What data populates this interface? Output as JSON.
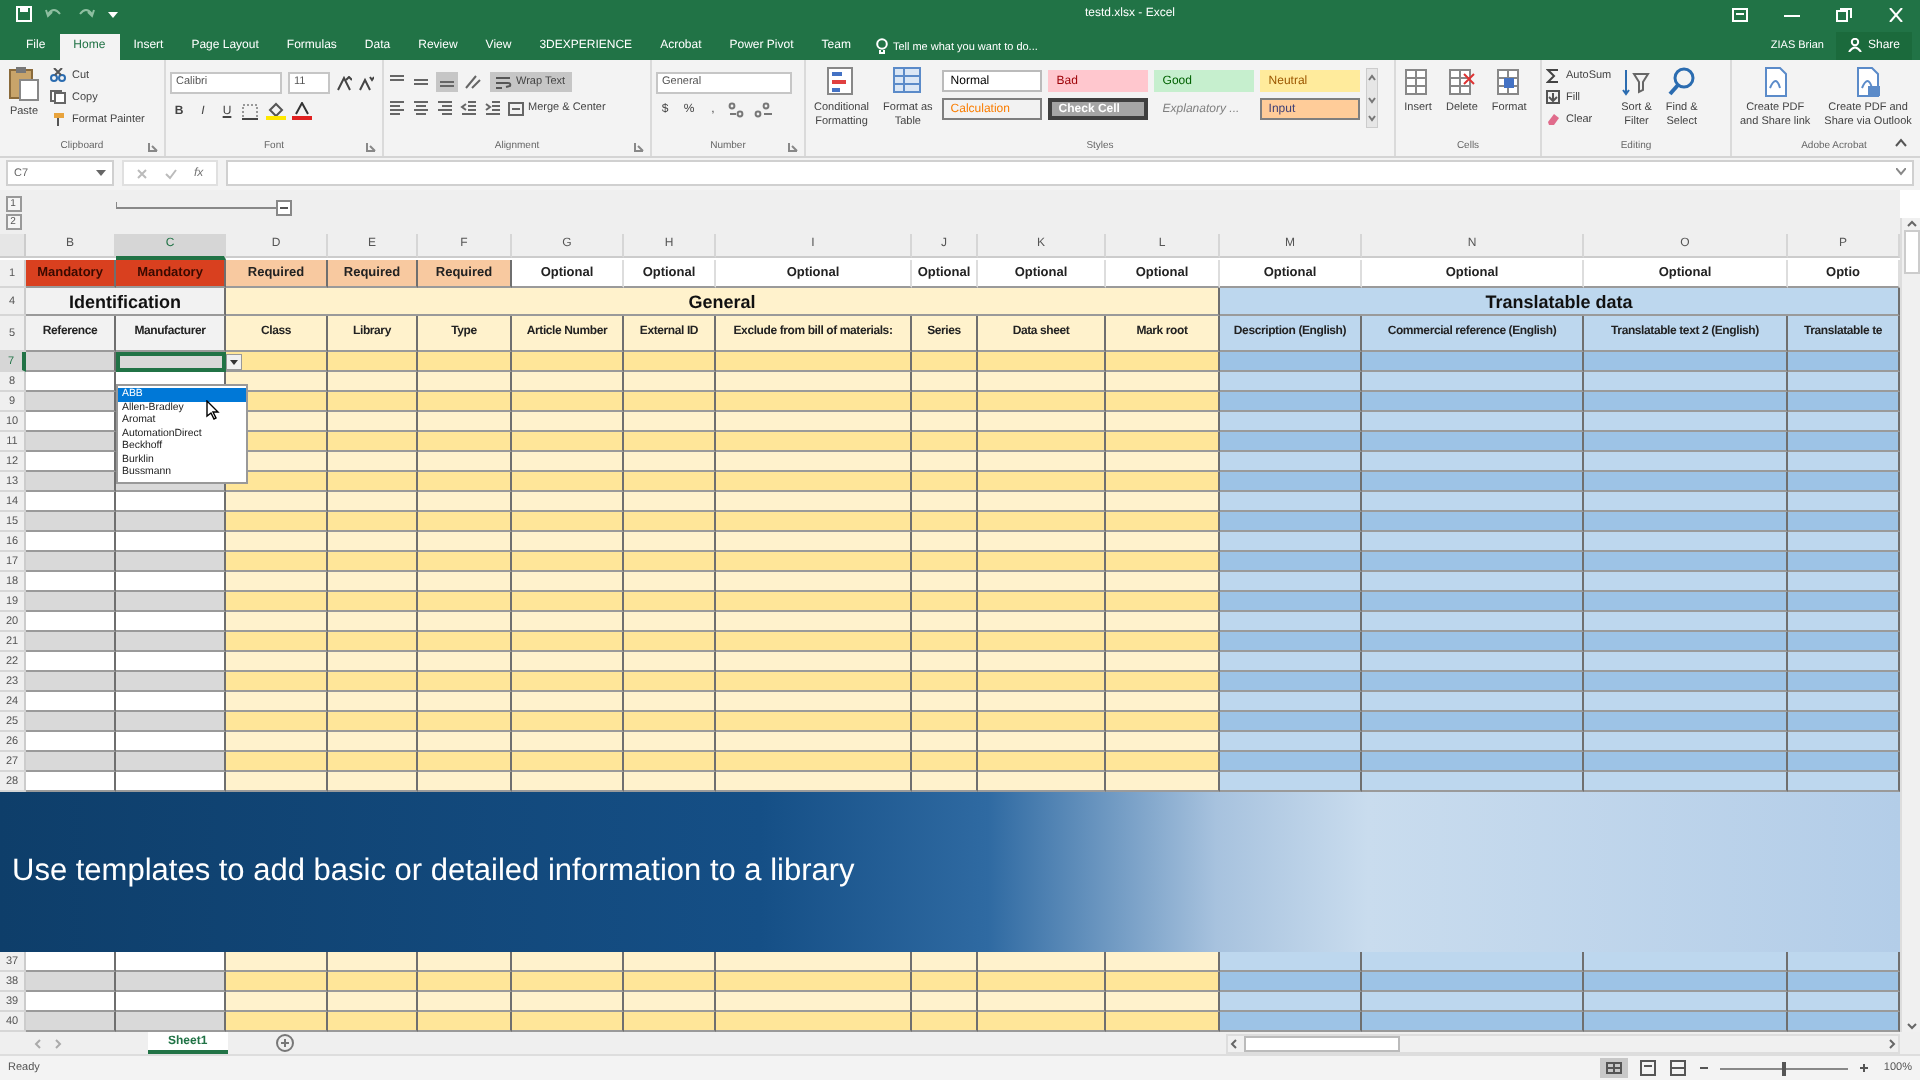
{
  "title_bar": {
    "title": "testd.xlsx - Excel"
  },
  "tabs": [
    {
      "label": "File",
      "selected": false
    },
    {
      "label": "Home",
      "selected": true
    },
    {
      "label": "Insert",
      "selected": false
    },
    {
      "label": "Page Layout",
      "selected": false
    },
    {
      "label": "Formulas",
      "selected": false
    },
    {
      "label": "Data",
      "selected": false
    },
    {
      "label": "Review",
      "selected": false
    },
    {
      "label": "View",
      "selected": false
    },
    {
      "label": "3DEXPERIENCE",
      "selected": false
    },
    {
      "label": "Acrobat",
      "selected": false
    },
    {
      "label": "Power Pivot",
      "selected": false
    },
    {
      "label": "Team",
      "selected": false
    }
  ],
  "tell_me": {
    "placeholder": "Tell me what you want to do..."
  },
  "account": {
    "user": "ZIAS Brian",
    "share": "Share"
  },
  "ribbon": {
    "clipboard": {
      "label": "Clipboard",
      "paste": "Paste",
      "cut": "Cut",
      "copy": "Copy",
      "format_painter": "Format Painter"
    },
    "font": {
      "label": "Font",
      "name": "Calibri",
      "size": "11",
      "bold": "B",
      "italic": "I",
      "underline": "U"
    },
    "alignment": {
      "label": "Alignment",
      "wrap_text": {
        "label": "Wrap Text",
        "on": true
      },
      "merge": "Merge & Center"
    },
    "number": {
      "label": "Number",
      "format": "General",
      "currency": "$",
      "percent": "%",
      "comma": ","
    },
    "styles": {
      "label": "Styles",
      "conditional": [
        "Conditional",
        "Formatting"
      ],
      "format_table": [
        "Format as",
        "Table"
      ],
      "gallery": [
        {
          "label": "Normal",
          "kind": "normal"
        },
        {
          "label": "Bad",
          "kind": "bad"
        },
        {
          "label": "Good",
          "kind": "good"
        },
        {
          "label": "Neutral",
          "kind": "neutral"
        },
        {
          "label": "Calculation",
          "kind": "calculation"
        },
        {
          "label": "Check Cell",
          "kind": "check"
        },
        {
          "label": "Explanatory ...",
          "kind": "explanatory"
        },
        {
          "label": "Input",
          "kind": "input"
        }
      ]
    },
    "cells": {
      "label": "Cells",
      "buttons": [
        "Insert",
        "Delete",
        "Format"
      ]
    },
    "editing": {
      "label": "Editing",
      "autosum": "AutoSum",
      "fill": "Fill",
      "clear": "Clear",
      "sort": [
        "Sort &",
        "Filter"
      ],
      "find": [
        "Find &",
        "Select"
      ]
    },
    "acrobat": {
      "label": "Adobe Acrobat",
      "buttons": [
        [
          "Create PDF",
          "and Share link"
        ],
        [
          "Create PDF and",
          "Share via Outlook"
        ]
      ]
    }
  },
  "formula_bar": {
    "name_box": "C7",
    "function_label": "fx"
  },
  "outline": {
    "levels": [
      "1",
      "2"
    ]
  },
  "sheet": {
    "header_rows": [
      "1",
      "4",
      "5"
    ],
    "sections": [
      {
        "title": "Identification",
        "kind": "identification",
        "columns": [
          {
            "letter": "B",
            "requirement": "Mandatory",
            "kind": "mandatory",
            "heading": "Reference",
            "selected": false
          },
          {
            "letter": "C",
            "requirement": "Mandatory",
            "kind": "mandatory",
            "heading": "Manufacturer",
            "selected": true
          }
        ]
      },
      {
        "title": "General",
        "kind": "general",
        "columns": [
          {
            "letter": "D",
            "requirement": "Required",
            "kind": "required",
            "heading": "Class",
            "selected": false
          },
          {
            "letter": "E",
            "requirement": "Required",
            "kind": "required",
            "heading": "Library",
            "selected": false
          },
          {
            "letter": "F",
            "requirement": "Required",
            "kind": "required",
            "heading": "Type",
            "selected": false
          },
          {
            "letter": "G",
            "requirement": "Optional",
            "kind": "optional",
            "heading": "Article Number",
            "selected": false
          },
          {
            "letter": "H",
            "requirement": "Optional",
            "kind": "optional",
            "heading": "External ID",
            "selected": false
          },
          {
            "letter": "I",
            "requirement": "Optional",
            "kind": "optional",
            "heading": "Exclude from bill of materials:",
            "selected": false
          },
          {
            "letter": "J",
            "requirement": "Optional",
            "kind": "optional",
            "heading": "Series",
            "selected": false
          },
          {
            "letter": "K",
            "requirement": "Optional",
            "kind": "optional",
            "heading": "Data sheet",
            "selected": false
          },
          {
            "letter": "L",
            "requirement": "Optional",
            "kind": "optional",
            "heading": "Mark root",
            "selected": false
          }
        ]
      },
      {
        "title": "Translatable data",
        "kind": "translatable",
        "columns": [
          {
            "letter": "M",
            "requirement": "Optional",
            "kind": "optional",
            "heading": "Description (English)",
            "selected": false
          },
          {
            "letter": "N",
            "requirement": "Optional",
            "kind": "optional",
            "heading": "Commercial reference (English)",
            "selected": false
          },
          {
            "letter": "O",
            "requirement": "Optional",
            "kind": "optional",
            "heading": "Translatable text 2 (English)",
            "selected": false
          },
          {
            "letter": "P",
            "requirement": "Optio",
            "kind": "optional",
            "heading": "Translatable te",
            "selected": false
          }
        ]
      }
    ],
    "rows_above": [
      {
        "number": "7",
        "selected": true
      },
      {
        "number": "8",
        "selected": false
      },
      {
        "number": "9",
        "selected": false
      },
      {
        "number": "10",
        "selected": false
      },
      {
        "number": "11",
        "selected": false
      },
      {
        "number": "12",
        "selected": false
      },
      {
        "number": "13",
        "selected": false
      },
      {
        "number": "14",
        "selected": false
      },
      {
        "number": "15",
        "selected": false
      },
      {
        "number": "16",
        "selected": false
      },
      {
        "number": "17",
        "selected": false
      },
      {
        "number": "18",
        "selected": false
      },
      {
        "number": "19",
        "selected": false
      },
      {
        "number": "20",
        "selected": false
      },
      {
        "number": "21",
        "selected": false
      },
      {
        "number": "22",
        "selected": false
      },
      {
        "number": "23",
        "selected": false
      },
      {
        "number": "24",
        "selected": false
      },
      {
        "number": "25",
        "selected": false
      },
      {
        "number": "26",
        "selected": false
      },
      {
        "number": "27",
        "selected": false
      },
      {
        "number": "28",
        "selected": false
      }
    ],
    "rows_below": [
      {
        "number": "37",
        "selected": false
      },
      {
        "number": "38",
        "selected": false
      },
      {
        "number": "39",
        "selected": false
      },
      {
        "number": "40",
        "selected": false
      }
    ]
  },
  "validation_list": {
    "items": [
      {
        "label": "ABB",
        "selected": true
      },
      {
        "label": "Allen-Bradley",
        "selected": false
      },
      {
        "label": "Aromat",
        "selected": false
      },
      {
        "label": "AutomationDirect",
        "selected": false
      },
      {
        "label": "Beckhoff",
        "selected": false
      },
      {
        "label": "Burklin",
        "selected": false
      },
      {
        "label": "Bussmann",
        "selected": false
      }
    ]
  },
  "banner": {
    "caption": "Use templates to add basic or detailed information to a library"
  },
  "sheet_tabs": [
    {
      "label": "Sheet1",
      "selected": true
    }
  ],
  "status_bar": {
    "text": "Ready",
    "zoom": "100%",
    "zoom_slider": {
      "level": 0.5
    }
  }
}
